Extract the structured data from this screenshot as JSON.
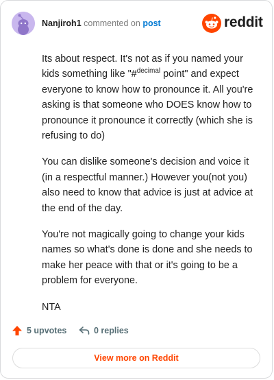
{
  "header": {
    "username": "Nanjiroh1",
    "action_text": "commented on",
    "post_link": "post",
    "brand_name": "reddit",
    "brand_color": "#ff4500",
    "avatar_icon": "snoo-avatar-icon"
  },
  "comment": {
    "p1_before": "Its about respect. It's not as if you named your kids something like \"#",
    "p1_sup": "decimal",
    "p1_after": " point\" and expect everyone to know how to pronounce it. All you're asking is that someone who DOES know how to pronounce it pronounce it correctly (which she is refusing to do)",
    "p2": "You can dislike someone's decision and voice it (in a respectful manner.) However you(not you) also need to know that advice is just at advice at the end of the day.",
    "p3": "You're not magically going to change your kids names so what's done is done and she needs to make her peace with that or it's going to be a problem for everyone.",
    "p4": "NTA"
  },
  "actions": {
    "upvotes_label": "5 upvotes",
    "replies_label": "0 replies",
    "upvote_icon": "upvote-arrow-icon",
    "reply_icon": "reply-arrow-icon"
  },
  "footer": {
    "view_more_label": "View more on Reddit"
  }
}
